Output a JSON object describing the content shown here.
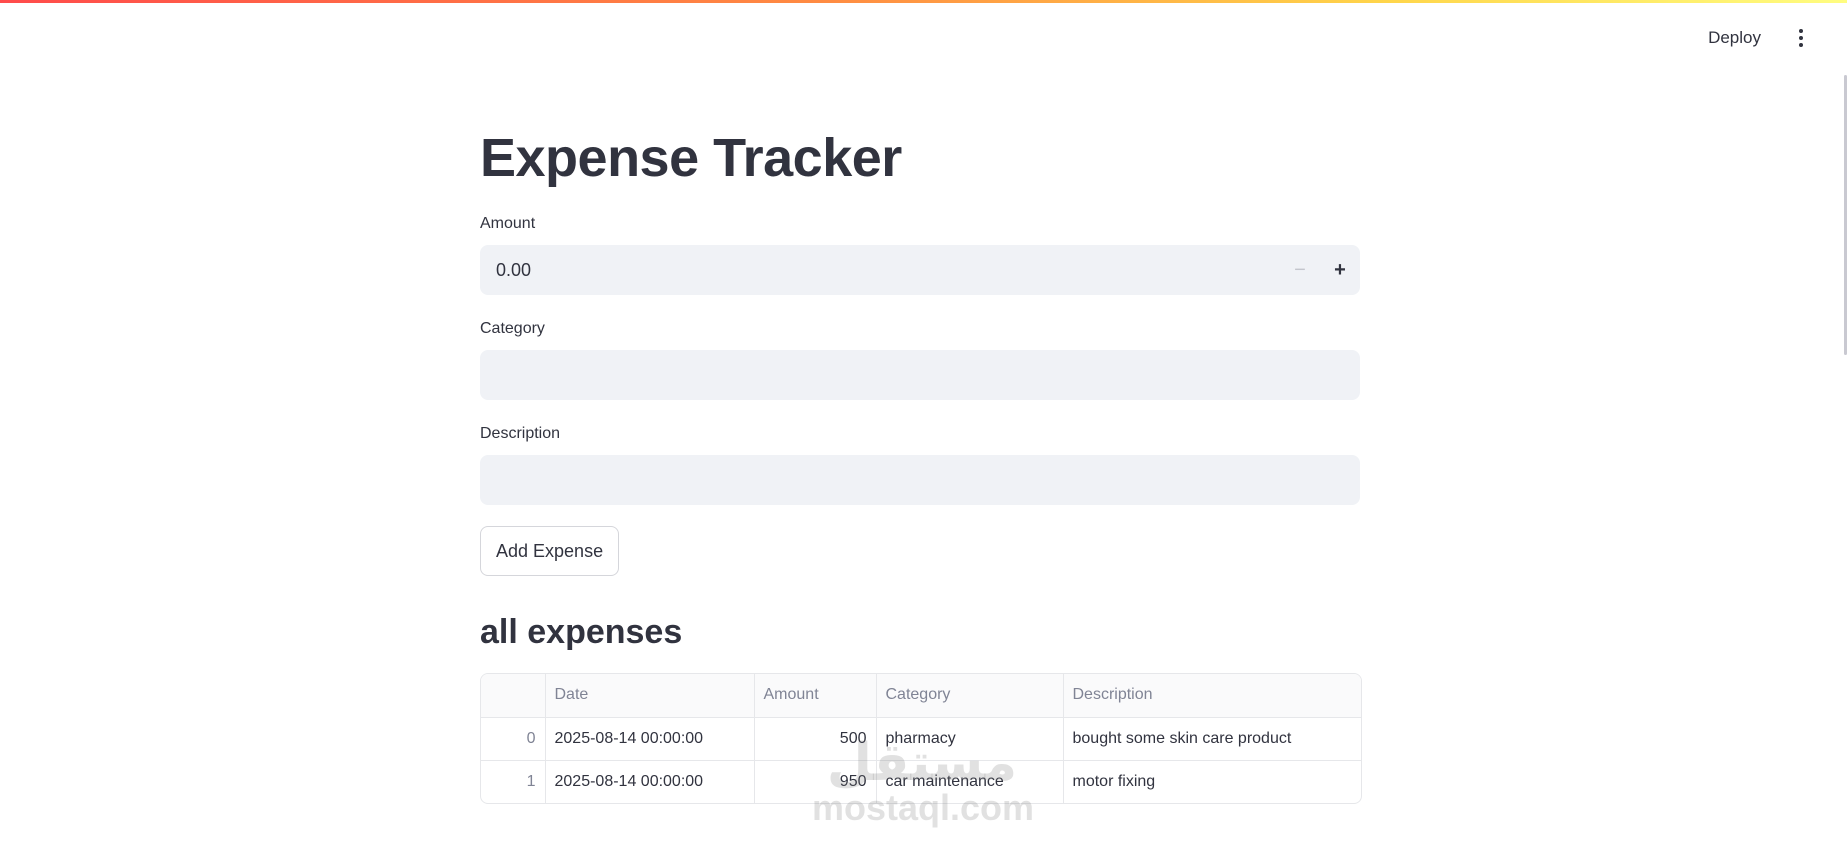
{
  "header": {
    "deploy_label": "Deploy",
    "menu_icon": "more-vertical-icon"
  },
  "page": {
    "title": "Expense Tracker"
  },
  "form": {
    "amount": {
      "label": "Amount",
      "value": "0.00",
      "minus_symbol": "−",
      "plus_symbol": "+"
    },
    "category": {
      "label": "Category",
      "value": ""
    },
    "description": {
      "label": "Description",
      "value": ""
    },
    "add_button_label": "Add Expense"
  },
  "expenses": {
    "title": "all expenses",
    "columns": [
      "",
      "Date",
      "Amount",
      "Category",
      "Description"
    ],
    "rows": [
      {
        "index": "0",
        "date": "2025-08-14 00:00:00",
        "amount": "500",
        "category": "pharmacy",
        "description": "bought some skin care product"
      },
      {
        "index": "1",
        "date": "2025-08-14 00:00:00",
        "amount": "950",
        "category": "car maintenance",
        "description": "motor fixing"
      }
    ]
  },
  "watermark": {
    "arabic": "مستقل",
    "latin": "mostaql.com"
  },
  "colors": {
    "text": "#31333f",
    "input_bg": "#f0f2f6",
    "muted": "#808495",
    "gradient": [
      "#ff4b4b",
      "#ffd54a",
      "#fffd80"
    ]
  }
}
